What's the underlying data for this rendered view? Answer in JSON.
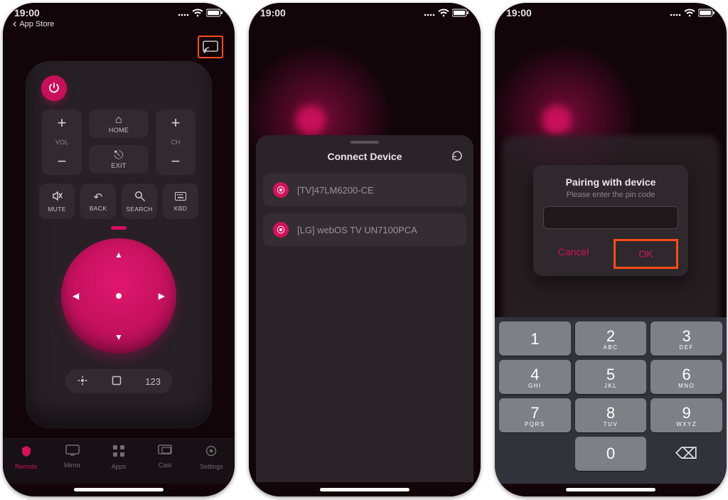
{
  "status": {
    "time": "19:00"
  },
  "back_store": "App Store",
  "remote": {
    "vol_label": "VOL",
    "ch_label": "CH",
    "home": "HOME",
    "exit": "EXIT",
    "mute": "MUTE",
    "back": "BACK",
    "search": "SEARCH",
    "kbd": "KBD",
    "mode_123": "123"
  },
  "tabs": {
    "remote": "Remote",
    "mirror": "Mirror",
    "apps": "Apps",
    "cast": "Cast",
    "settings": "Settings"
  },
  "connect": {
    "title": "Connect Device",
    "devices": [
      {
        "name": "[TV]47LM6200-CE"
      },
      {
        "name": "[LG] webOS TV UN7100PCA"
      }
    ]
  },
  "pairing": {
    "title": "Pairing with device",
    "subtitle": "Please enter the pin code",
    "cancel": "Cancel",
    "ok": "OK"
  },
  "keypad": {
    "keys": [
      {
        "n": "1",
        "l": ""
      },
      {
        "n": "2",
        "l": "ABC"
      },
      {
        "n": "3",
        "l": "DEF"
      },
      {
        "n": "4",
        "l": "GHI"
      },
      {
        "n": "5",
        "l": "JKL"
      },
      {
        "n": "6",
        "l": "MNO"
      },
      {
        "n": "7",
        "l": "PQRS"
      },
      {
        "n": "8",
        "l": "TUV"
      },
      {
        "n": "9",
        "l": "WXYZ"
      },
      {
        "n": "",
        "l": ""
      },
      {
        "n": "0",
        "l": ""
      },
      {
        "n": "⌫",
        "l": ""
      }
    ]
  }
}
